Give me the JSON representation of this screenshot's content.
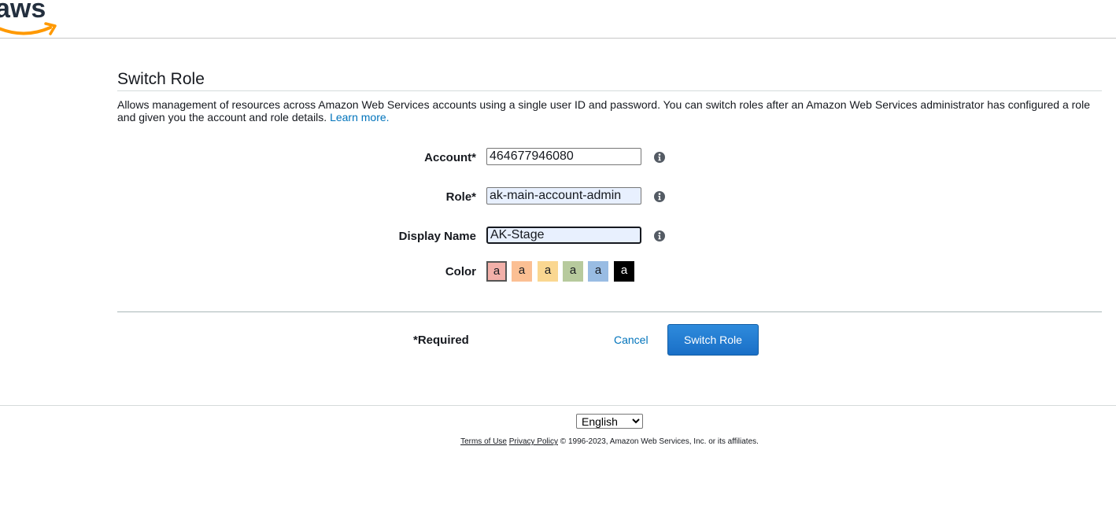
{
  "brand": {
    "logo_text": "aws",
    "logo_colors": {
      "text": "#232f3e",
      "smile": "#ff9900"
    }
  },
  "page": {
    "title": "Switch Role",
    "description": "Allows management of resources across Amazon Web Services accounts using a single user ID and password. You can switch roles after an Amazon Web Services administrator has configured a role and given you the account and role details.",
    "learn_more": "Learn more."
  },
  "form": {
    "account": {
      "label": "Account*",
      "value": "464677946080",
      "info_icon": "info-circle-icon"
    },
    "role": {
      "label": "Role*",
      "value": "ak-main-account-admin",
      "info_icon": "info-circle-icon"
    },
    "display_name": {
      "label": "Display Name",
      "value": "AK-Stage",
      "info_icon": "info-circle-icon"
    },
    "color": {
      "label": "Color",
      "swatches": [
        {
          "letter": "a",
          "color": "#f2b0a9",
          "selected": true
        },
        {
          "letter": "a",
          "color": "#fbbf93",
          "selected": false
        },
        {
          "letter": "a",
          "color": "#fad791",
          "selected": false
        },
        {
          "letter": "a",
          "color": "#b7ca9d",
          "selected": false
        },
        {
          "letter": "a",
          "color": "#99bce3",
          "selected": false
        },
        {
          "letter": "a",
          "color": "#000000",
          "selected": false
        }
      ]
    },
    "required_note": "*Required",
    "cancel_label": "Cancel",
    "submit_label": "Switch Role"
  },
  "footer": {
    "language": "English",
    "terms": "Terms of Use",
    "privacy": "Privacy Policy",
    "copyright": "© 1996-2023, Amazon Web Services, Inc. or its affiliates."
  },
  "colors": {
    "accent_link": "#0073bb",
    "primary_button": "#1a6fc7",
    "text": "#16191f"
  }
}
